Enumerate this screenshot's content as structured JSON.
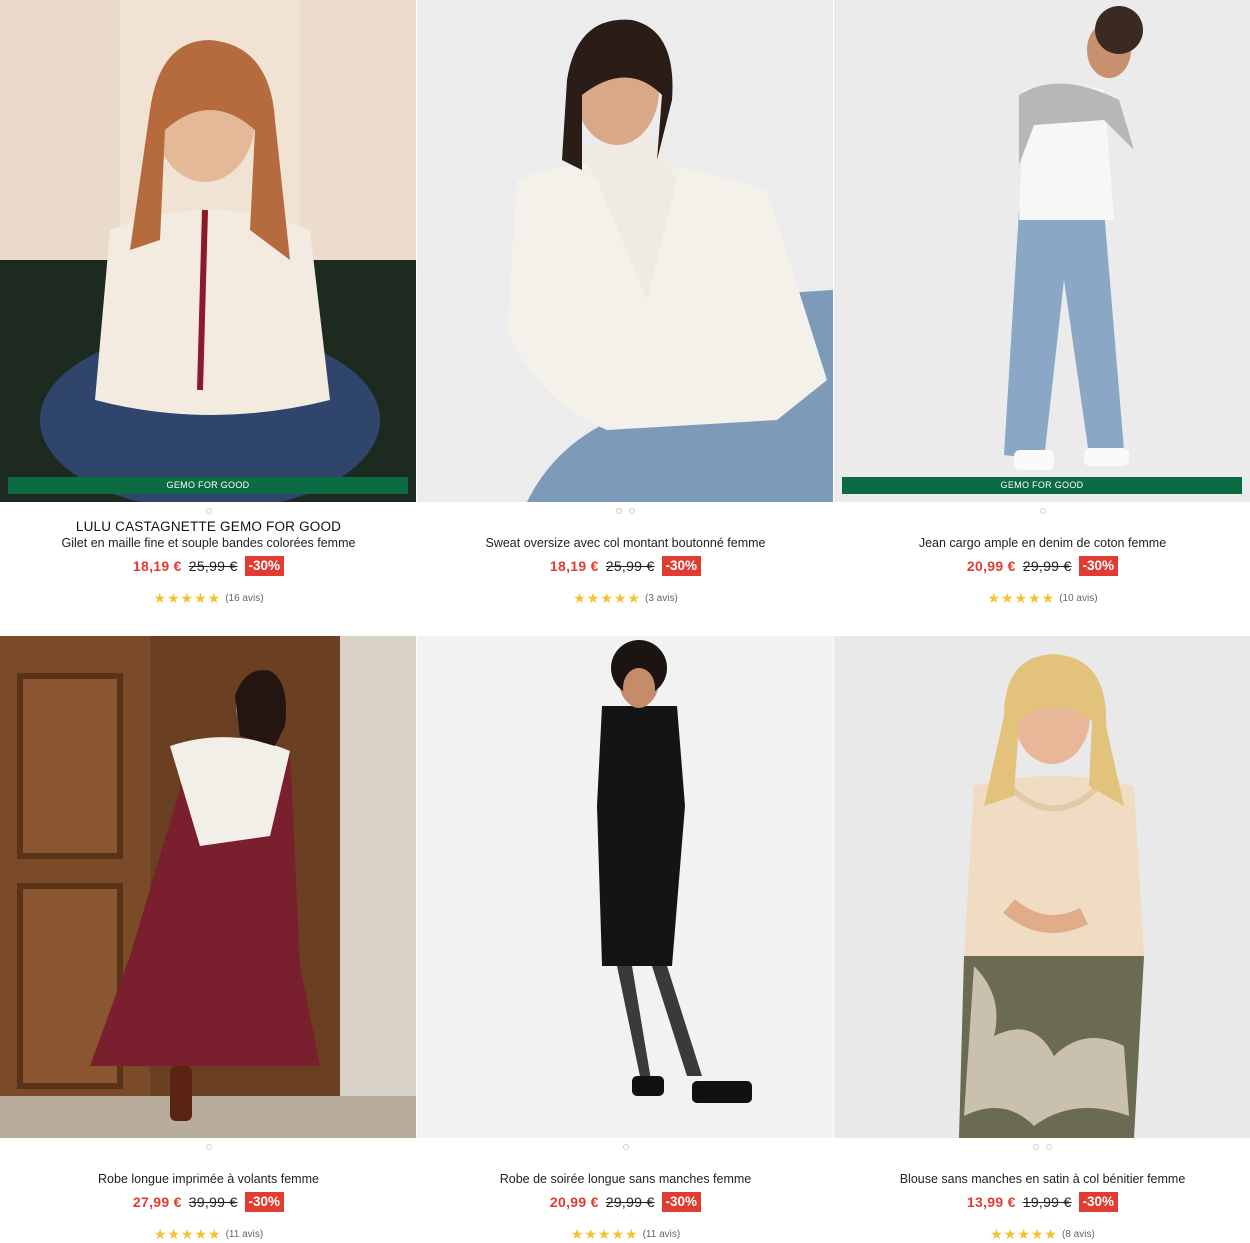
{
  "products": [
    {
      "brand": "LULU CASTAGNETTE GEMO FOR GOOD",
      "title": "Gilet en maille fine et souple bandes colorées femme",
      "price": "18,19 €",
      "old_price": "25,99 €",
      "discount": "-30%",
      "stars": "★★★★★",
      "reviews": "(16 avis)",
      "badge": "GEMO FOR GOOD",
      "dots": 1
    },
    {
      "brand": "",
      "title": "Sweat oversize avec col montant boutonné femme",
      "price": "18,19 €",
      "old_price": "25,99 €",
      "discount": "-30%",
      "stars": "★★★★★",
      "reviews": "(3 avis)",
      "badge": "",
      "dots": 2
    },
    {
      "brand": "",
      "title": "Jean cargo ample en denim de coton femme",
      "price": "20,99 €",
      "old_price": "29,99 €",
      "discount": "-30%",
      "stars": "★★★★★",
      "reviews": "(10 avis)",
      "badge": "GEMO FOR GOOD",
      "dots": 1
    },
    {
      "brand": "",
      "title": "Robe longue imprimée à volants femme",
      "price": "27,99 €",
      "old_price": "39,99 €",
      "discount": "-30%",
      "stars": "★★★★★",
      "reviews": "(11 avis)",
      "badge": "",
      "dots": 1
    },
    {
      "brand": "",
      "title": "Robe de soirée longue sans manches femme",
      "price": "20,99 €",
      "old_price": "29,99 €",
      "discount": "-30%",
      "stars": "★★★★★",
      "reviews": "(11 avis)",
      "badge": "",
      "dots": 1
    },
    {
      "brand": "",
      "title": "Blouse sans manches en satin à col bénitier femme",
      "price": "13,99 €",
      "old_price": "19,99 €",
      "discount": "-30%",
      "stars": "★★★★★",
      "reviews": "(8 avis)",
      "badge": "",
      "dots": 2
    }
  ]
}
